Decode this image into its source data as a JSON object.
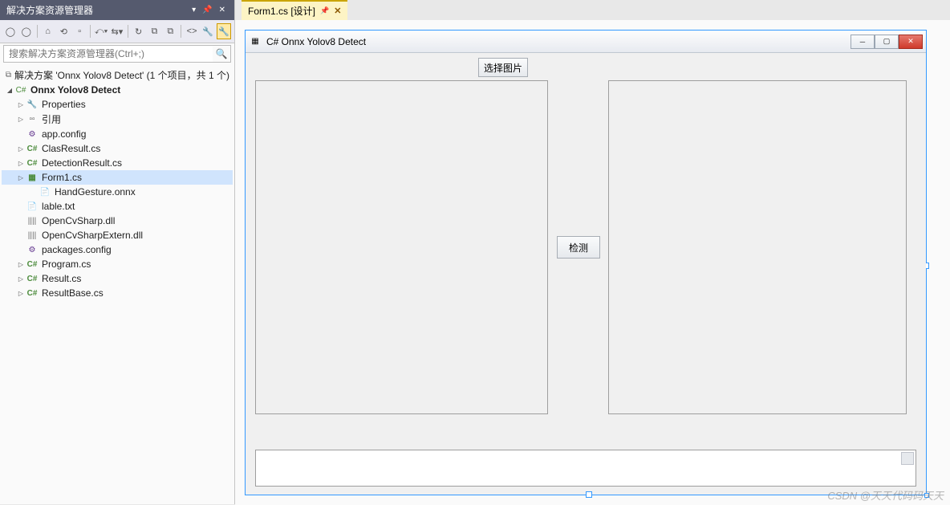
{
  "solutionExplorer": {
    "title": "解决方案资源管理器",
    "searchPlaceholder": "搜索解决方案资源管理器(Ctrl+;)",
    "solution": "解决方案 'Onnx Yolov8 Detect' (1 个项目，共 1 个)",
    "project": "Onnx Yolov8 Detect",
    "nodes": {
      "properties": "Properties",
      "references": "引用",
      "appConfig": "app.config",
      "clasResult": "ClasResult.cs",
      "detectionResult": "DetectionResult.cs",
      "form1": "Form1.cs",
      "handGesture": "HandGesture.onnx",
      "lable": "lable.txt",
      "opencvsharp": "OpenCvSharp.dll",
      "opencvsharpExtern": "OpenCvSharpExtern.dll",
      "packagesConfig": "packages.config",
      "program": "Program.cs",
      "result": "Result.cs",
      "resultBase": "ResultBase.cs"
    }
  },
  "tab": {
    "label": "Form1.cs [设计]"
  },
  "form": {
    "title": "C# Onnx Yolov8 Detect",
    "selectImageBtn": "选择图片",
    "detectBtn": "检测"
  },
  "watermark": "CSDN @天天代码码天天"
}
